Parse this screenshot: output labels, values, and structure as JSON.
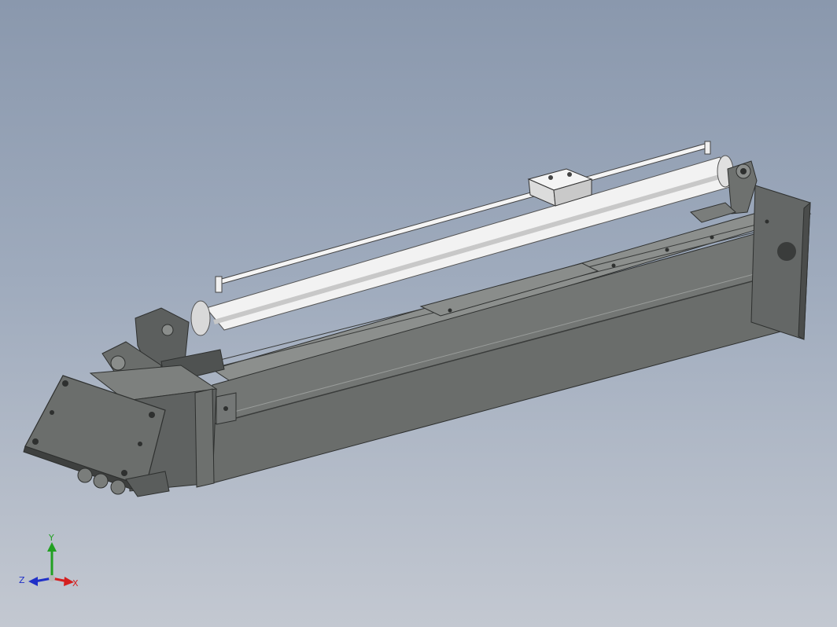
{
  "viewport": {
    "background_top": "#8a98ad",
    "background_bottom": "#c3c8d1"
  },
  "model": {
    "frame_color": "#6e716f",
    "frame_dark": "#4a4c4b",
    "cylinder_color": "#f2f2f2",
    "icons": [
      "hydraulic-cylinder-icon",
      "mounting-block-icon",
      "end-plate-icon",
      "linear-rail-icon"
    ]
  },
  "triad": {
    "x_label": "X",
    "y_label": "Y",
    "z_label": "Z",
    "x_color": "#d42020",
    "y_color": "#22a022",
    "z_color": "#2030c8"
  }
}
